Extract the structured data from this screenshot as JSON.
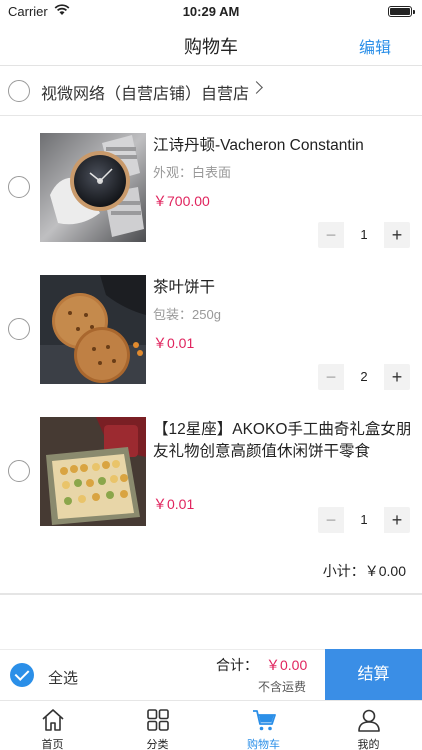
{
  "status_bar": {
    "carrier": "Carrier",
    "time": "10:29 AM"
  },
  "nav": {
    "title": "购物车",
    "edit_label": "编辑"
  },
  "store": {
    "name": "视微网络（自营店铺）自营店"
  },
  "items": [
    {
      "name": "江诗丹顿-Vacheron Constantin",
      "spec": "外观：白表面",
      "price": "￥700.00",
      "qty": "1",
      "image": "watch-photo"
    },
    {
      "name": "茶叶饼干",
      "spec": "包装：250g",
      "price": "￥0.01",
      "qty": "2",
      "image": "tea-cookie-photo"
    },
    {
      "name": "【12星座】AKOKO手工曲奇礼盒女朋友礼物创意高颜值休闲饼干零食",
      "spec": "",
      "price": "￥0.01",
      "qty": "1",
      "image": "cookie-gift-box-photo"
    }
  ],
  "stepper": {
    "minus": "−",
    "plus": "+"
  },
  "subtotal": {
    "label": "小计：",
    "value": "￥0.00"
  },
  "footer": {
    "select_all": "全选",
    "total_label": "合计：",
    "total_value": "￥0.00",
    "shipping_note": "不含运费",
    "checkout_label": "结算"
  },
  "tabs": [
    {
      "label": "首页",
      "icon": "home-icon"
    },
    {
      "label": "分类",
      "icon": "category-icon"
    },
    {
      "label": "购物车",
      "icon": "cart-icon",
      "active": true
    },
    {
      "label": "我的",
      "icon": "profile-icon"
    }
  ],
  "colors": {
    "accent": "#2b8fe8",
    "price": "#e0245e",
    "checkout_bg": "#3a8ee6"
  }
}
